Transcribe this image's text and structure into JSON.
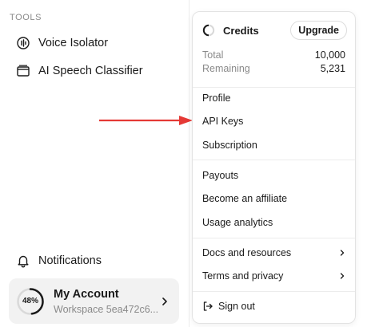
{
  "sidebar": {
    "section_label": "TOOLS",
    "items": [
      {
        "label": "Voice Isolator",
        "icon": "voice-isolator-icon"
      },
      {
        "label": "AI Speech Classifier",
        "icon": "window-icon"
      }
    ],
    "notifications": {
      "label": "Notifications",
      "icon": "bell-icon"
    },
    "account": {
      "progress": "48%",
      "progress_value": 0.48,
      "name": "My Account",
      "workspace": "Workspace 5ea472c6...",
      "icon": "chevron-right-icon"
    }
  },
  "menu": {
    "credits": {
      "label": "Credits",
      "upgrade_label": "Upgrade",
      "total_label": "Total",
      "total_value": "10,000",
      "remaining_label": "Remaining",
      "remaining_value": "5,231"
    },
    "group1": [
      "Profile",
      "API Keys",
      "Subscription"
    ],
    "group2": [
      "Payouts",
      "Become an affiliate",
      "Usage analytics"
    ],
    "group3": [
      "Docs and resources",
      "Terms and privacy"
    ],
    "sign_out": "Sign out"
  },
  "colors": {
    "arrow": "#e53935",
    "muted_text": "#8a8a8a",
    "card_bg": "#f2f2f2"
  }
}
